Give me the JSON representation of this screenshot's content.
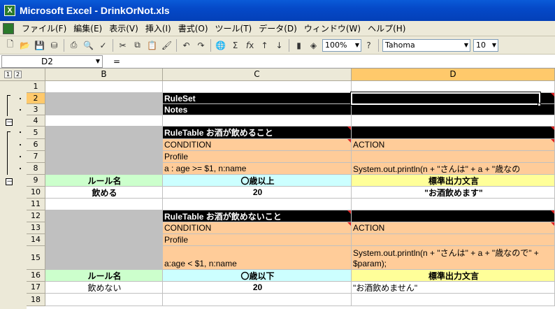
{
  "window": {
    "title": "Microsoft Excel - DrinkOrNot.xls"
  },
  "menu": [
    "ファイル(F)",
    "編集(E)",
    "表示(V)",
    "挿入(I)",
    "書式(O)",
    "ツール(T)",
    "データ(D)",
    "ウィンドウ(W)",
    "ヘルプ(H)"
  ],
  "toolbar": {
    "zoom": "100%",
    "font": "Tahoma",
    "size": "10"
  },
  "formula": {
    "name_box": "D2",
    "equals": "=",
    "value": ""
  },
  "outline_levels": [
    "1",
    "2"
  ],
  "columns": [
    "B",
    "C",
    "D"
  ],
  "rows": [
    {
      "n": "1",
      "b": "",
      "c": "",
      "d": ""
    },
    {
      "n": "2",
      "b": "",
      "c": "RuleSet",
      "d": ""
    },
    {
      "n": "3",
      "b": "",
      "c": "Notes",
      "d": ""
    },
    {
      "n": "4",
      "b": "",
      "c": "",
      "d": ""
    },
    {
      "n": "5",
      "b": "",
      "c": "RuleTable お酒が飲めること",
      "d": ""
    },
    {
      "n": "6",
      "b": "",
      "c": "CONDITION",
      "d": "ACTION"
    },
    {
      "n": "7",
      "b": "",
      "c": "Profile",
      "d": ""
    },
    {
      "n": "8",
      "b": "",
      "c": "a : age >= $1, n:name",
      "d": "System.out.println(n + \"さんは\" + a + \"歳なの"
    },
    {
      "n": "9",
      "b": "ルール名",
      "c": "〇歳以上",
      "d": "標準出力文言"
    },
    {
      "n": "10",
      "b": "飲める",
      "c": "20",
      "d": "\"お酒飲めます\""
    },
    {
      "n": "11",
      "b": "",
      "c": "",
      "d": ""
    },
    {
      "n": "12",
      "b": "",
      "c": "RuleTable お酒が飲めないこと",
      "d": ""
    },
    {
      "n": "13",
      "b": "",
      "c": "CONDITION",
      "d": "ACTION"
    },
    {
      "n": "14",
      "b": "",
      "c": "Profile",
      "d": ""
    },
    {
      "n": "15",
      "b": "",
      "c": "a:age < $1, n:name",
      "d": "System.out.println(n + \"さんは\" + a + \"歳なので\" + $param);"
    },
    {
      "n": "16",
      "b": "ルール名",
      "c": "〇歳以下",
      "d": "標準出力文言"
    },
    {
      "n": "17",
      "b": "飲めない",
      "c": "20",
      "d": "\"お酒飲めません\""
    },
    {
      "n": "18",
      "b": "",
      "c": "",
      "d": ""
    }
  ],
  "outline_marks": [
    "・",
    "・",
    "－",
    "・",
    "・",
    "・",
    "・",
    "－"
  ]
}
